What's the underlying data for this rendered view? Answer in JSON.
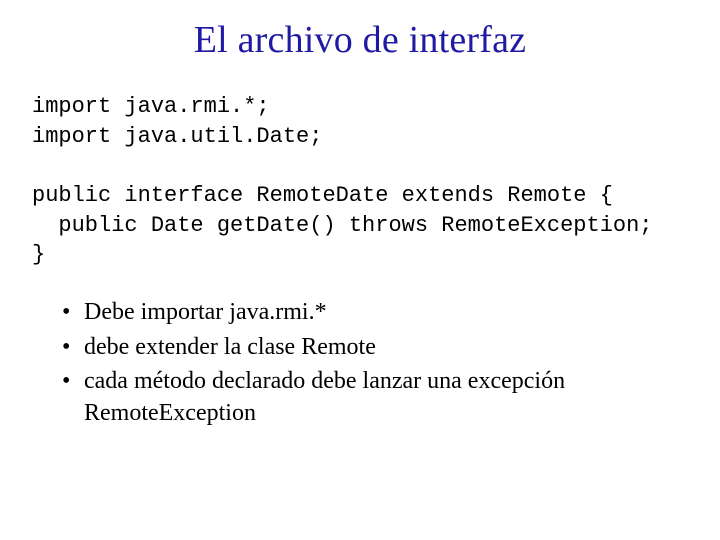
{
  "title": "El archivo de interfaz",
  "code": {
    "line1": "import java.rmi.*;",
    "line2": "import java.util.Date;",
    "line3": "public interface RemoteDate extends Remote {",
    "line4": "  public Date getDate() throws RemoteException;",
    "line5": "}"
  },
  "bullets": [
    "Debe importar java.rmi.*",
    "debe extender la clase Remote",
    "cada método declarado debe lanzar una excepción RemoteException"
  ]
}
